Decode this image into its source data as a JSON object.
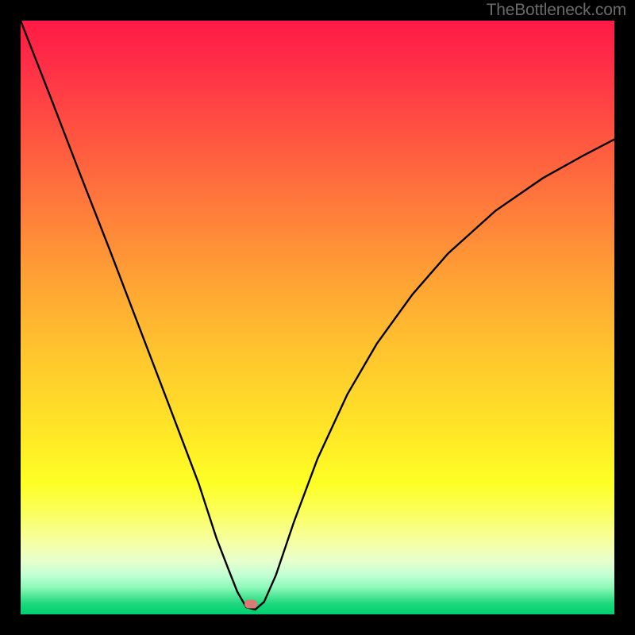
{
  "watermark": "TheBottleneck.com",
  "marker": {
    "x_frac": 0.388,
    "y_frac": 0.983
  },
  "chart_data": {
    "type": "line",
    "title": "",
    "xlabel": "",
    "ylabel": "",
    "xlim": [
      0,
      1
    ],
    "ylim": [
      0,
      1
    ],
    "series": [
      {
        "name": "bottleneck-curve",
        "x": [
          0.0,
          0.05,
          0.1,
          0.15,
          0.2,
          0.25,
          0.3,
          0.33,
          0.35,
          0.365,
          0.38,
          0.395,
          0.41,
          0.43,
          0.46,
          0.5,
          0.55,
          0.6,
          0.66,
          0.72,
          0.8,
          0.88,
          0.95,
          1.0
        ],
        "y": [
          1.0,
          0.872,
          0.742,
          0.614,
          0.483,
          0.352,
          0.22,
          0.128,
          0.076,
          0.038,
          0.012,
          0.008,
          0.021,
          0.066,
          0.155,
          0.262,
          0.37,
          0.456,
          0.539,
          0.608,
          0.68,
          0.735,
          0.774,
          0.8
        ]
      }
    ],
    "background_gradient_meaning": "vertical severity scale (red high, green low)",
    "marker_point": {
      "x": 0.388,
      "y": 0.017,
      "note": "optimum / minimum bottleneck"
    }
  }
}
